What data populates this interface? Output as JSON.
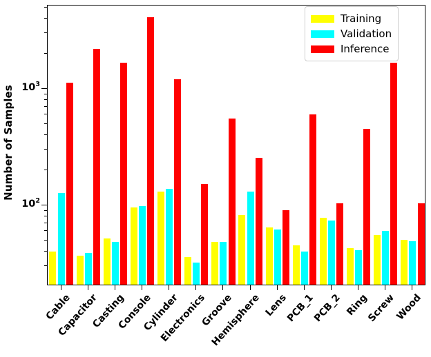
{
  "chart_data": {
    "type": "bar",
    "title": "",
    "xlabel": "",
    "ylabel": "Number of Samples",
    "yscale": "log",
    "ylim": [
      30,
      5000
    ],
    "grid": false,
    "legend_position": "upper right",
    "ytick_labels": [
      "10²",
      "10³"
    ],
    "ytick_values": [
      100,
      1000
    ],
    "categories": [
      "Cable",
      "Capacitor",
      "Casting",
      "Console",
      "Cylinder",
      "Electronics",
      "Groove",
      "Hemisphere",
      "Lens",
      "PCB_1",
      "PCB_2",
      "Ring",
      "Screw",
      "Wood"
    ],
    "series": [
      {
        "name": "Training",
        "color": "#ffff00",
        "values": [
          40,
          37,
          52,
          95,
          131,
          36,
          48,
          82,
          64,
          45,
          78,
          43,
          55,
          50
        ]
      },
      {
        "name": "Validation",
        "color": "#00ffff",
        "values": [
          127,
          39,
          48,
          98,
          138,
          32,
          48,
          130,
          62,
          40,
          74,
          41,
          60,
          49
        ]
      },
      {
        "name": "Inference",
        "color": "#ff0000",
        "values": [
          1120,
          2200,
          1680,
          4100,
          1200,
          151,
          550,
          254,
          91,
          600,
          103,
          452,
          1680,
          104
        ]
      }
    ]
  },
  "axes": {
    "y_title": "Number of Samples",
    "y_major_ticks": [
      {
        "label_mantissa": "10",
        "label_exponent": "2",
        "value": 100
      },
      {
        "label_mantissa": "10",
        "label_exponent": "3",
        "value": 1000
      }
    ]
  },
  "legend": {
    "items": [
      {
        "label": "Training",
        "color": "#ffff00"
      },
      {
        "label": "Validation",
        "color": "#00ffff"
      },
      {
        "label": "Inference",
        "color": "#ff0000"
      }
    ]
  }
}
